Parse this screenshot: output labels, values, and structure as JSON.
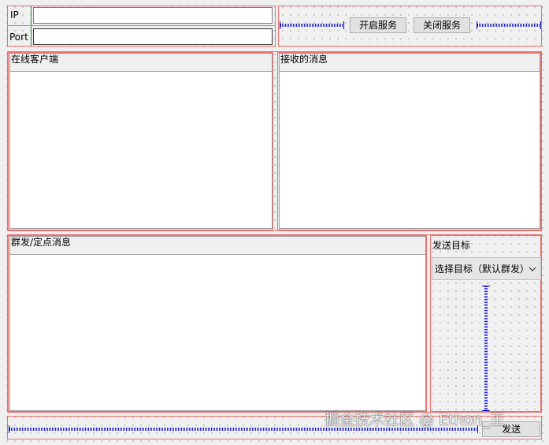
{
  "connection": {
    "ip_label": "IP",
    "ip_value": "",
    "port_label": "Port",
    "port_value": ""
  },
  "server": {
    "start_label": "开启服务",
    "stop_label": "关闭服务"
  },
  "panels": {
    "online_clients_title": "在线客户端",
    "received_messages_title": "接收的消息",
    "broadcast_title": "群发/定点消息"
  },
  "target": {
    "label": "发送目标",
    "selected": "选择目标（默认群发）"
  },
  "send_label": "发送",
  "watermark": "掘金技术社区 @ Ethon_王",
  "icons": {
    "dropdown": "chevron-down-icon"
  },
  "colors": {
    "layout_frame": "#e8706e",
    "spacer": "#1e1ec8"
  }
}
